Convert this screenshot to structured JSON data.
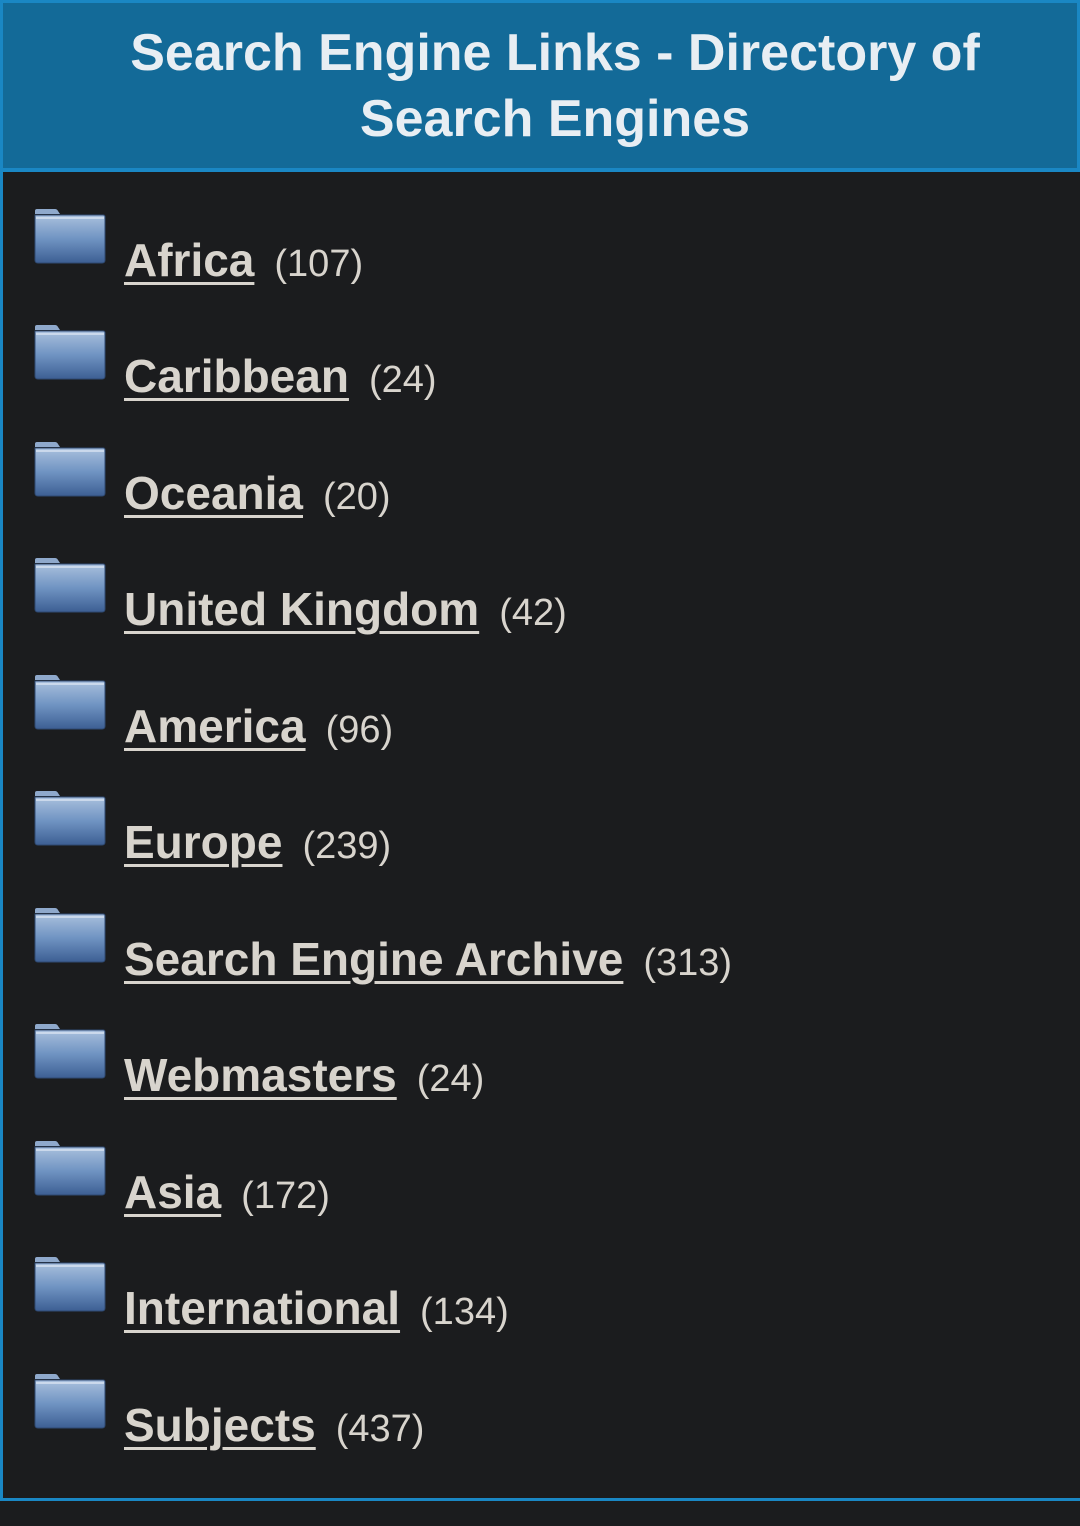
{
  "header": {
    "title": "Search Engine Links - Directory of Search Engines"
  },
  "categories": [
    {
      "label": "Africa",
      "count": "(107)",
      "icon": "folder-icon"
    },
    {
      "label": "Caribbean",
      "count": "(24)",
      "icon": "folder-icon"
    },
    {
      "label": "Oceania",
      "count": "(20)",
      "icon": "folder-icon"
    },
    {
      "label": "United Kingdom",
      "count": "(42)",
      "icon": "folder-icon"
    },
    {
      "label": "America",
      "count": "(96)",
      "icon": "folder-icon"
    },
    {
      "label": "Europe",
      "count": "(239)",
      "icon": "folder-icon"
    },
    {
      "label": "Search Engine Archive",
      "count": "(313)",
      "icon": "folder-icon"
    },
    {
      "label": "Webmasters",
      "count": "(24)",
      "icon": "folder-icon"
    },
    {
      "label": "Asia",
      "count": "(172)",
      "icon": "folder-icon"
    },
    {
      "label": "International",
      "count": "(134)",
      "icon": "folder-icon"
    },
    {
      "label": "Subjects",
      "count": "(437)",
      "icon": "folder-icon"
    }
  ],
  "colors": {
    "header_bg": "#136a98",
    "header_border": "#1a87c4",
    "page_bg": "#1b1c1e",
    "text": "#d8d4cd"
  }
}
